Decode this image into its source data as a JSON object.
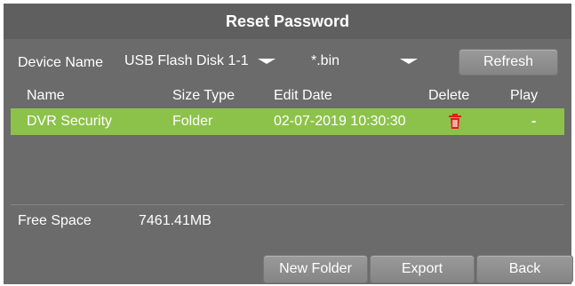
{
  "dialog": {
    "title": "Reset Password"
  },
  "toolbar": {
    "device_label": "Device Name",
    "device_value": "USB Flash Disk 1-1",
    "filter_value": "*.bin",
    "refresh_label": "Refresh"
  },
  "table": {
    "headers": {
      "name": "Name",
      "size_type": "Size Type",
      "edit_date": "Edit Date",
      "delete": "Delete",
      "play": "Play"
    },
    "rows": [
      {
        "name": "DVR Security",
        "size_type": "Folder",
        "edit_date": "02-07-2019 10:30:30",
        "delete_icon": "trash-icon",
        "play_text": "-"
      }
    ],
    "selected_row_color": "#8cc24a"
  },
  "footer": {
    "free_space_label": "Free Space",
    "free_space_value": "7461.41MB",
    "new_folder_label": "New Folder",
    "export_label": "Export",
    "back_label": "Back"
  },
  "colors": {
    "dialog_bg": "#6b6b6b",
    "title_bg": "#5f5f5f",
    "delete_icon": "#e31b1b"
  }
}
